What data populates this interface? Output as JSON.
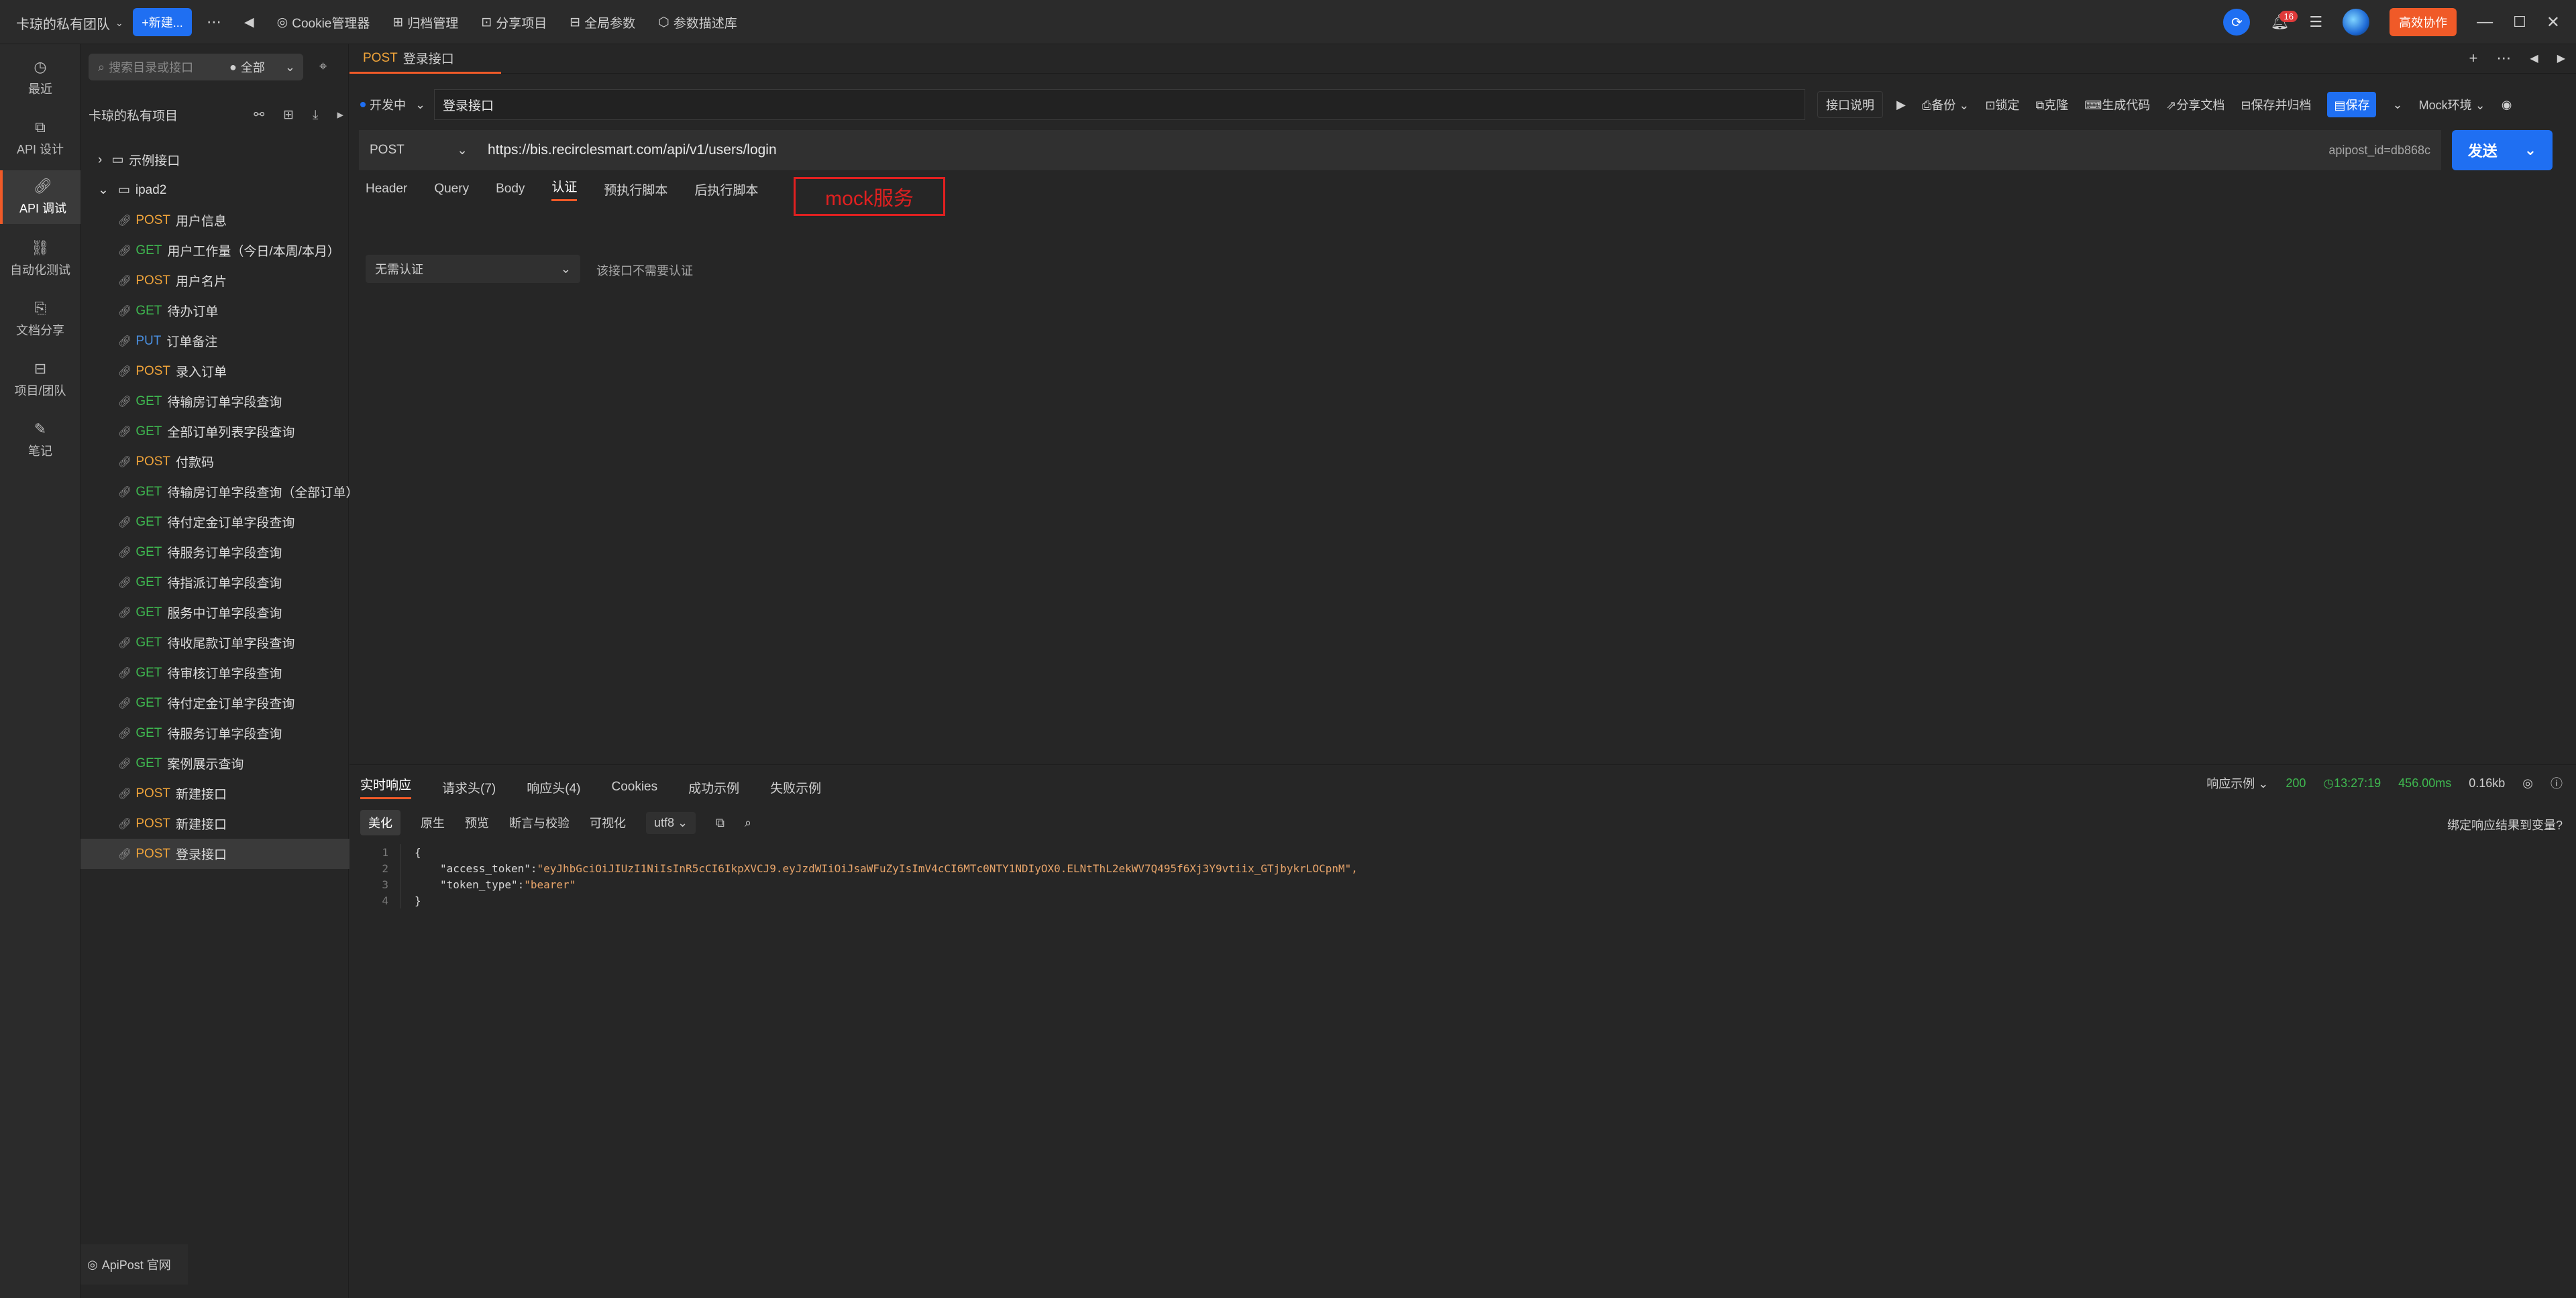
{
  "topbar": {
    "team": "卡琼的私有团队",
    "new_btn": "+新建...",
    "menu": [
      "Cookie管理器",
      "归档管理",
      "分享项目",
      "全局参数",
      "参数描述库"
    ],
    "badge_count": "16",
    "collab_btn": "高效协作"
  },
  "leftnav": {
    "items": [
      "最近",
      "API 设计",
      "API 调试",
      "自动化测试",
      "文档分享",
      "项目/团队",
      "笔记"
    ]
  },
  "tree": {
    "search_placeholder": "搜索目录或接口",
    "filter": "全部",
    "project": "卡琼的私有项目",
    "folders": [
      "示例接口",
      "ipad2"
    ],
    "items": [
      {
        "method": "POST",
        "name": "用户信息"
      },
      {
        "method": "GET",
        "name": "用户工作量（今日/本周/本月）"
      },
      {
        "method": "POST",
        "name": "用户名片"
      },
      {
        "method": "GET",
        "name": "待办订单"
      },
      {
        "method": "PUT",
        "name": "订单备注"
      },
      {
        "method": "POST",
        "name": "录入订单"
      },
      {
        "method": "GET",
        "name": "待输房订单字段查询"
      },
      {
        "method": "GET",
        "name": "全部订单列表字段查询"
      },
      {
        "method": "POST",
        "name": "付款码"
      },
      {
        "method": "GET",
        "name": "待输房订单字段查询（全部订单）"
      },
      {
        "method": "GET",
        "name": "待付定金订单字段查询"
      },
      {
        "method": "GET",
        "name": "待服务订单字段查询"
      },
      {
        "method": "GET",
        "name": "待指派订单字段查询"
      },
      {
        "method": "GET",
        "name": "服务中订单字段查询"
      },
      {
        "method": "GET",
        "name": "待收尾款订单字段查询"
      },
      {
        "method": "GET",
        "name": "待审核订单字段查询"
      },
      {
        "method": "GET",
        "name": "待付定金订单字段查询"
      },
      {
        "method": "GET",
        "name": "待服务订单字段查询"
      },
      {
        "method": "GET",
        "name": "案例展示查询"
      },
      {
        "method": "POST",
        "name": "新建接口"
      },
      {
        "method": "POST",
        "name": "新建接口"
      },
      {
        "method": "POST",
        "name": "登录接口"
      }
    ],
    "site": "ApiPost 官网"
  },
  "main": {
    "tab": {
      "method": "POST",
      "name": "登录接口"
    },
    "env": "开发中",
    "api_name": "登录接口",
    "doc_btn": "接口说明",
    "actions": [
      "备份",
      "锁定",
      "克隆",
      "生成代码",
      "分享文档",
      "保存并归档"
    ],
    "save": "保存",
    "mock_env": "Mock环境",
    "method": "POST",
    "url": "https://bis.recirclesmart.com/api/v1/users/login",
    "url_tail": "apipost_id=db868c",
    "send": "发送",
    "req_tabs": [
      "Header",
      "Query",
      "Body",
      "认证",
      "预执行脚本",
      "后执行脚本"
    ],
    "annotation": "mock服务",
    "auth_type": "无需认证",
    "auth_hint": "该接口不需要认证"
  },
  "response": {
    "tabs": [
      "实时响应",
      "请求头(7)",
      "响应头(4)",
      "Cookies",
      "成功示例",
      "失败示例"
    ],
    "example_sel": "响应示例",
    "status": "200",
    "time": "13:27:19",
    "duration": "456.00ms",
    "size": "0.16kb",
    "formats": [
      "美化",
      "原生",
      "预览",
      "断言与校验",
      "可视化"
    ],
    "encoding": "utf8",
    "bind_hint": "绑定响应结果到变量?",
    "code": {
      "l1": "{",
      "k1": "\"access_token\"",
      "v1": "\"eyJhbGciOiJIUzI1NiIsInR5cCI6IkpXVCJ9.eyJzdWIiOiJsaWFuZyIsImV4cCI6MTc0NTY1NDIyOX0.ELNtThL2ekWV7Q495f6Xj3Y9vtiix_GTjbykrLOCpnM\",",
      "k2": "\"token_type\"",
      "v2": "\"bearer\"",
      "l4": "}"
    }
  }
}
